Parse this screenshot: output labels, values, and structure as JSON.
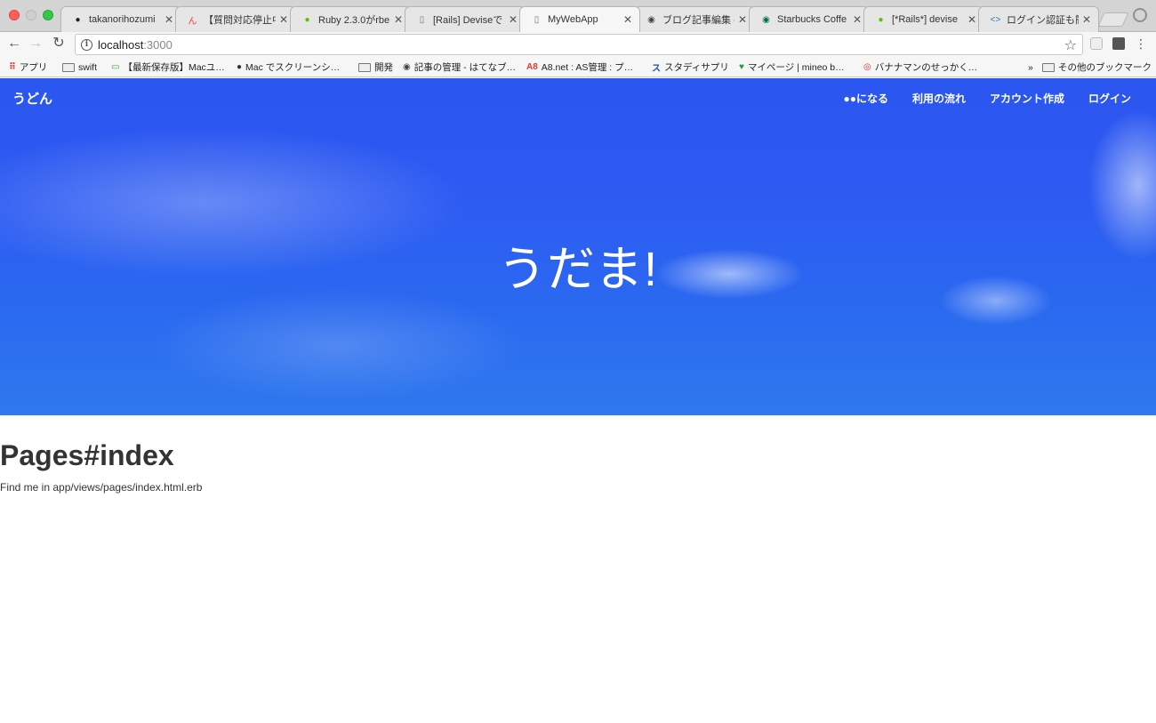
{
  "browser": {
    "tabs": [
      {
        "title": "takanorihozumi",
        "icon": "github-icon",
        "color": "#222222",
        "glyph": "●"
      },
      {
        "title": "【質問対応停止中",
        "icon": "hatena-icon",
        "color": "#e8443b",
        "glyph": "ん"
      },
      {
        "title": "Ruby 2.3.0がrbe",
        "icon": "qiita-icon",
        "color": "#55c500",
        "glyph": "●"
      },
      {
        "title": "[Rails] Deviseで",
        "icon": "page-icon",
        "color": "#777777",
        "glyph": "▯"
      },
      {
        "title": "MyWebApp",
        "icon": "page-icon",
        "color": "#777777",
        "glyph": "▯"
      },
      {
        "title": "ブログ記事編集 -",
        "icon": "hatena-blog-icon",
        "color": "#444444",
        "glyph": "◉"
      },
      {
        "title": "Starbucks Coffe",
        "icon": "starbucks-icon",
        "color": "#00704a",
        "glyph": "◉"
      },
      {
        "title": "[*Rails*] devise",
        "icon": "qiita-icon",
        "color": "#55c500",
        "glyph": "●"
      },
      {
        "title": "ログイン認証も簡",
        "icon": "code-icon",
        "color": "#2b7bb9",
        "glyph": "<>"
      }
    ],
    "tab_close_glyph": "✕",
    "url_host": "localhost",
    "url_port": ":3000",
    "bookmarks": [
      {
        "label": "アプリ",
        "icon": "apps-icon"
      },
      {
        "label": "swift",
        "icon": "folder-icon"
      },
      {
        "label": "【最新保存版】Macユ…",
        "icon": "bookmark-icon"
      },
      {
        "label": "Mac でスクリーンシ…",
        "icon": "apple-icon"
      },
      {
        "label": "開発",
        "icon": "folder-icon"
      },
      {
        "label": "記事の管理 - はてなブ…",
        "icon": "hatena-blog-icon"
      },
      {
        "label": "A8.net : AS管理 : プ…",
        "icon": "a8-icon"
      },
      {
        "label": "スタディサプリ",
        "icon": "studysapuri-icon"
      },
      {
        "label": "マイページ | mineo b…",
        "icon": "mineo-icon"
      },
      {
        "label": "バナナマンのせっかく…",
        "icon": "bananaman-icon"
      }
    ],
    "bookmarks_overflow": "»",
    "other_bookmarks": "その他のブックマーク"
  },
  "site": {
    "brand": "うどん",
    "nav": [
      "●●になる",
      "利用の流れ",
      "アカウント作成",
      "ログイン"
    ],
    "hero_title": "うだま!"
  },
  "main": {
    "heading": "Pages#index",
    "text": "Find me in app/views/pages/index.html.erb"
  },
  "colors": {
    "hero_blue": "#2d5cf2",
    "text_dark": "#333333"
  }
}
